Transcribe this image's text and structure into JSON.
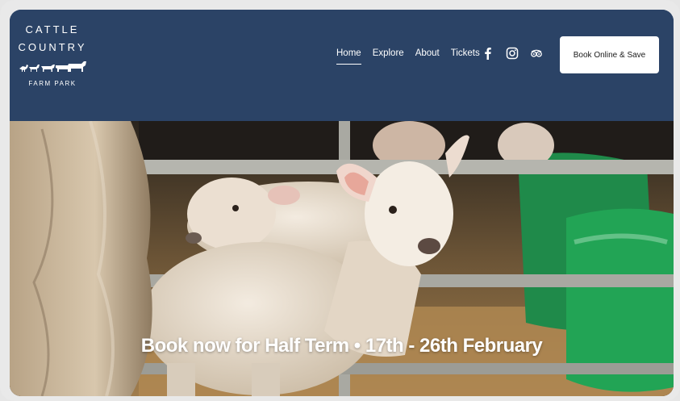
{
  "logo": {
    "line1": "CATTLE",
    "line2": "COUNTRY",
    "line3": "FARM PARK"
  },
  "nav": {
    "items": [
      {
        "label": "Home",
        "active": true
      },
      {
        "label": "Explore",
        "active": false
      },
      {
        "label": "About",
        "active": false
      },
      {
        "label": "Tickets",
        "active": false
      }
    ]
  },
  "social": {
    "icons": [
      "facebook-icon",
      "instagram-icon",
      "tripadvisor-icon"
    ]
  },
  "cta": {
    "label": "Book Online & Save"
  },
  "hero": {
    "banner": "Book now for Half Term  • 17th - 26th February"
  },
  "colors": {
    "header_bg": "#2b4366",
    "button_bg": "#ffffff"
  }
}
